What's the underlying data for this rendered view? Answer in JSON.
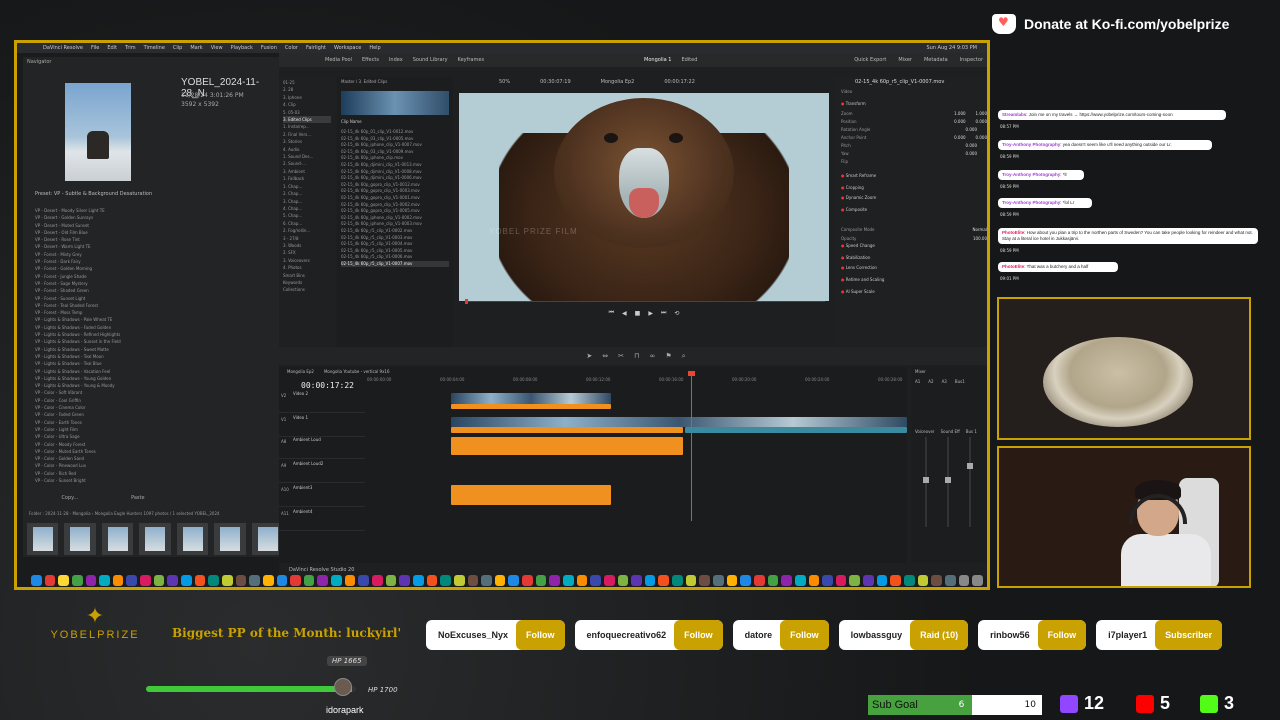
{
  "donate": {
    "text": "Donate at Ko-fi.com/yobelprize"
  },
  "menubar": {
    "app": "DaVinci Resolve",
    "items": [
      "File",
      "Edit",
      "Trim",
      "Timeline",
      "Clip",
      "Mark",
      "View",
      "Playback",
      "Fusion",
      "Color",
      "Fairlight",
      "Workspace",
      "Help"
    ],
    "clock": "Sun Aug 24 9:03 PM"
  },
  "lightroom": {
    "navigator": "Navigator",
    "title": "YOBEL_2024-11-28_N",
    "meta_date": "11/28/24 3:01:26 PM",
    "meta_size": "3592 x 5392",
    "preset_header": "Preset: VP - Subtle & Background Desaturation",
    "presets": [
      "VP - Desert - Moody Silver Light TE",
      "VP - Desert - Golden Sunrays",
      "VP - Desert - Muted Sunset",
      "VP - Desert - Old Film Blue",
      "VP - Desert - Rose Tint",
      "VP - Desert - Warm Light TE",
      "VP - Forest - Misty Grey",
      "VP - Forest - Dark Fairy",
      "VP - Forest - Golden Morning",
      "VP - Forest - Jungle Shade",
      "VP - Forest - Sage Mystery",
      "VP - Forest - Shaded Green",
      "VP - Forest - Sunset Light",
      "VP - Forest - Teal Shaded Forest",
      "VP - Forest - Moss Temp",
      "VP - Lights & Shadows - Pale Wheat TE",
      "VP - Lights & Shadows - Faded Golden",
      "VP - Lights & Shadows - Refined Highlights",
      "VP - Lights & Shadows - Sunset in the Field",
      "VP - Lights & Shadows - Sweet Matte",
      "VP - Lights & Shadows - Teal Moon",
      "VP - Lights & Shadows - Teal Blue",
      "VP - Lights & Shadows - Vacation Feel",
      "VP - Lights & Shadows - Young Golden",
      "VP - Lights & Shadows - Young & Moody",
      "VP - Color - Soft Vibrant",
      "VP - Color - Cool Griffin",
      "VP - Color - Cinema Color",
      "VP - Color - Faded Green",
      "VP - Color - Earth Tones",
      "VP - Color - Light Film",
      "VP - Color - Ultra Sage",
      "VP - Color - Moody Forest",
      "VP - Color - Muted Earth Tones",
      "VP - Color - Golden Sand",
      "VP - Color - Pinewood Lux",
      "VP - Color - Rich Red",
      "VP - Color - Sunset Bright",
      "VP - Color - Sierra Rose",
      "VP - Color - Teal Golden"
    ],
    "copy_label": "Copy...",
    "paste_label": "Paste",
    "filmstrip_info": "Folder : 2024-11-28 - Mongolia › Mongolia Eagle Hunters  1097 photos / 1 selected  YOBEL_2024"
  },
  "resolve": {
    "top_tabs": [
      "Media Pool",
      "Effects",
      "Index",
      "Sound Library",
      "Keyframes"
    ],
    "project": "Mongolia 1",
    "project_status": "Edited",
    "top_right": [
      "Quick Export",
      "Mixer",
      "Metadata",
      "Inspector"
    ],
    "zoom": "50%",
    "source_tc": "00:30:07:19",
    "timeline_name": "Mongolia Ep2",
    "viewer_tc": "00:00:17:22",
    "media_tree": [
      "01-25",
      "2. 28",
      "3. Iphone",
      "4. Clip",
      "5. 05-03",
      "3. Edited Clips",
      "1. Insta/rep...",
      "2. Final Vers...",
      "3. Stories",
      "4. Audio",
      "1. Sound Des...",
      "2. Sound-...",
      "3. Ambient",
      "1. Fallback",
      "1. Chap...",
      "2. Chap...",
      "3. Chap...",
      "4. Chap...",
      "5. Chap...",
      "6. Chap...",
      "2. Fog/rollin...",
      "3 - 27/8",
      "3. Woods",
      "2. SFX",
      "3. Voiceovers",
      "4. Photos",
      "Smart Bins",
      "Keywords",
      "Collections"
    ],
    "media_tree_selected": 5,
    "pool_path": "Master / 3. Edited Clips",
    "clip_column": "Clip Name",
    "clips": [
      "02-15_4k 60p_01_clip_V1-0012.mov",
      "02-15_4k 60p_03_clip_V1-0005.mov",
      "02-15_4k 60p_iphone_clip_V1-0007.mov",
      "02-15_4k 60p_03_clip_V1-0009.mov",
      "02-15_4k 60p_iphone_clip.mov",
      "02-15_4k 60p_djimini_clip_V1-0013.mov",
      "02-15_4k 60p_djimini_clip_V1-0008.mov",
      "02-15_4k 60p_djimini_clip_V1-0006.mov",
      "02-15_4k 60p_gopro_clip_V1-0012.mov",
      "02-15_4k 60p_gopro_clip_V1-0003.mov",
      "02-15_4k 60p_gopro_clip_V1-0001.mov",
      "02-15_4k 60p_gopro_clip_V1-0002.mov",
      "02-15_4k 60p_gopro_clip_V1-0005.mov",
      "02-15_4k 60p_iphone_clip_V1-0002.mov",
      "02-15_4k 60p_iphone_clip_V1-0003.mov",
      "02-15_4k 60p_r5_clip_V1-0002.mov",
      "02-15_4k 60p_r5_clip_V1-0003.mov",
      "02-15_4k 60p_r5_clip_V1-0004.mov",
      "02-15_4k 60p_r5_clip_V1-0005.mov",
      "02-15_4k 60p_r5_clip_V1-0006.mov",
      "02-15_4k 60p_r5_clip_V1-0007.mov"
    ],
    "clip_selected": 20,
    "watermark": "YOBEL PRIZE FILM",
    "inspector": {
      "clip": "02-15_4k 60p_r5_clip_V1-0007.mov",
      "tab": "Video",
      "section_transform": "Transform",
      "rows": [
        {
          "label": "Zoom",
          "x": "1.000",
          "y": "1.000"
        },
        {
          "label": "Position",
          "x": "0.000",
          "y": "0.000"
        },
        {
          "label": "Rotation Angle",
          "x": "0.000",
          "y": ""
        },
        {
          "label": "Anchor Point",
          "x": "0.000",
          "y": "0.000"
        },
        {
          "label": "Pitch",
          "x": "0.000",
          "y": ""
        },
        {
          "label": "Yaw",
          "x": "0.000",
          "y": ""
        },
        {
          "label": "Flip",
          "x": "",
          "y": ""
        }
      ],
      "sections": [
        "Smart Reframe",
        "Cropping",
        "Dynamic Zoom",
        "Composite",
        "Speed Change",
        "Stabilization",
        "Lens Correction",
        "Retime and Scaling",
        "AI Super Scale"
      ],
      "composite_mode_label": "Composite Mode",
      "composite_mode": "Normal",
      "opacity_label": "Opacity",
      "opacity": "100.00"
    },
    "timeline_tabs": [
      "Mongolia Ep2",
      "Mongolia Youtube - vertical 9x16"
    ],
    "timecode": "00:00:17:22",
    "ruler": [
      "00:00:00:00",
      "00:00:04:00",
      "00:00:08:00",
      "00:00:12:00",
      "00:00:16:00",
      "00:00:20:00",
      "00:00:24:00",
      "00:00:28:00"
    ],
    "tracks": [
      {
        "id": "V2",
        "name": "Video 2"
      },
      {
        "id": "V1",
        "name": "Video 1"
      },
      {
        "id": "A8",
        "name": "Ambient Loud"
      },
      {
        "id": "A9",
        "name": "Ambient Loud2"
      },
      {
        "id": "A10",
        "name": "Ambient3"
      },
      {
        "id": "A11",
        "name": "Ambient4"
      }
    ],
    "mixer_title": "Mixer",
    "mixer_channels": [
      "A1",
      "A2",
      "A3",
      "Bus1"
    ],
    "mixer_labels": [
      "Voiceover",
      "Sound Eff",
      "Bus 1"
    ],
    "bottom": "DaVinci Resolve Studio 20"
  },
  "chat": [
    {
      "user": "Streamlabs",
      "text": ": Join me on my travels → https://www.yobelprize.com/tours-coming-soon",
      "time": "08:57 PM",
      "color": "#a040d0"
    },
    {
      "user": "Troy-Anthony Photography",
      "text": ": yea doesn't seem like u'll need anything outside our Lr.",
      "time": "08:59 PM",
      "color": "#a040d0"
    },
    {
      "user": "Troy-Anthony Photography",
      "text": ": *lr",
      "time": "08:59 PM",
      "color": "#a040d0"
    },
    {
      "user": "Troy-Anthony Photography",
      "text": ": *lol Lr",
      "time": "08:59 PM",
      "color": "#a040d0"
    },
    {
      "user": "PhotoElite",
      "text": ": How about you plan a trip to the northen parts of Sweden? You can take people looking for reindeer and what not. Stay at a literal ice hotel in Jukkasjärvi.",
      "time": "08:59 PM",
      "color": "#e02060"
    },
    {
      "user": "PhotoElite",
      "text": ": That was a butchery and a half",
      "time": "09:01 PM",
      "color": "#e02060"
    }
  ],
  "brand": {
    "name": "YOBELPRIZE"
  },
  "biggest_pp": "Biggest PP of the Month: luckyirl'",
  "followers": [
    {
      "name": "NoExcuses_Nyx",
      "tag": "Follow"
    },
    {
      "name": "enfoquecreativo62",
      "tag": "Follow"
    },
    {
      "name": "datore",
      "tag": "Follow"
    },
    {
      "name": "lowbassguy",
      "tag": "Raid (10)"
    },
    {
      "name": "rinbow56",
      "tag": "Follow"
    },
    {
      "name": "i7player1",
      "tag": "Subscriber"
    }
  ],
  "hp": {
    "current_label": "HP 1665",
    "max_label": "HP 1700",
    "user": "idorapark",
    "fill": 0.979
  },
  "sub_goal": {
    "label": "Sub Goal",
    "current": "6",
    "max": "10",
    "fill": 0.6,
    "color": "#47a13f"
  },
  "counters": [
    {
      "platform": "twitch",
      "value": "12",
      "color": "#9146ff"
    },
    {
      "platform": "youtube",
      "value": "5",
      "color": "#ff0000"
    },
    {
      "platform": "kick",
      "value": "3",
      "color": "#53fc18"
    }
  ]
}
